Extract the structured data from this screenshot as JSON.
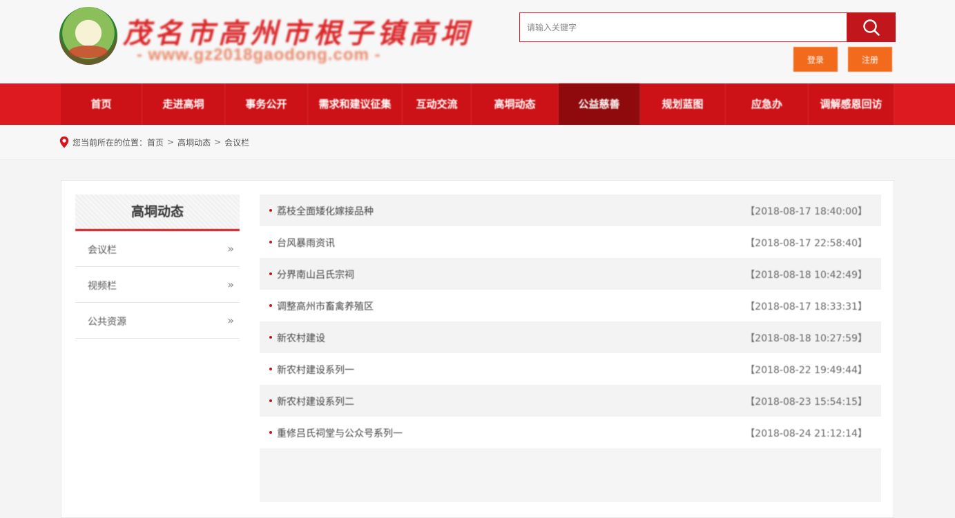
{
  "header": {
    "logo_title": "茂名市高州市根子镇高垌",
    "logo_url": "- www.gz2018gaodong.com -",
    "search": {
      "placeholder": "请输入关键字"
    },
    "login_label": "登录",
    "register_label": "注册"
  },
  "nav": {
    "items": [
      {
        "label": "首页"
      },
      {
        "label": "走进高垌"
      },
      {
        "label": "事务公开"
      },
      {
        "label": "需求和建议征集"
      },
      {
        "label": "互动交流"
      },
      {
        "label": "高垌动态"
      },
      {
        "label": "公益慈善"
      },
      {
        "label": "规划蓝图"
      },
      {
        "label": "应急办"
      },
      {
        "label": "调解感恩回访"
      }
    ],
    "active_index": 6
  },
  "breadcrumb": {
    "prefix": "您当前所在的位置：",
    "items": [
      "首页",
      "高垌动态",
      "会议栏"
    ],
    "separator": ">"
  },
  "sidebar": {
    "title": "高垌动态",
    "items": [
      {
        "label": "会议栏"
      },
      {
        "label": "视频栏"
      },
      {
        "label": "公共资源"
      }
    ]
  },
  "news": {
    "items": [
      {
        "title": "荔枝全面矮化嫁接品种",
        "date": "【2018-08-17 18:40:00】"
      },
      {
        "title": "台风暴雨资讯",
        "date": "【2018-08-17 22:58:40】"
      },
      {
        "title": "分界南山吕氏宗祠",
        "date": "【2018-08-18 10:42:49】"
      },
      {
        "title": "调整高州市畜禽养殖区",
        "date": "【2018-08-17 18:33:31】"
      },
      {
        "title": "新农村建设",
        "date": "【2018-08-18 10:27:59】"
      },
      {
        "title": "新农村建设系列一",
        "date": "【2018-08-22 19:49:44】"
      },
      {
        "title": "新农村建设系列二",
        "date": "【2018-08-23 15:54:15】"
      },
      {
        "title": "重修吕氏祠堂与公众号系列一",
        "date": "【2018-08-24 21:12:14】"
      }
    ]
  },
  "colors": {
    "brand_red": "#cd1217",
    "nav_active": "#8e0a0d",
    "auth_orange": "#f26b1d"
  }
}
